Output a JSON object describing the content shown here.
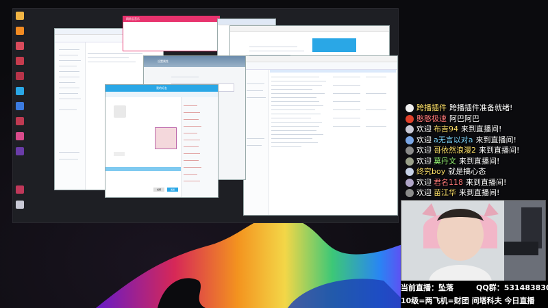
{
  "chat": {
    "messages": [
      {
        "prefix": "",
        "name": "跨播插件",
        "text": "跨播插件准备就绪!",
        "avatar_color": "#f0f0f0"
      },
      {
        "prefix": "",
        "name": "憨憨极速",
        "text": "阿巴阿巴",
        "avatar_color": "#e0402a"
      },
      {
        "prefix": "欢迎",
        "name": "布吉94",
        "text": "来到直播间!",
        "avatar_color": "#c9c9d6"
      },
      {
        "prefix": "欢迎",
        "name": "a无言以对a",
        "text": "来到直播间!",
        "avatar_color": "#7aa6e6"
      },
      {
        "prefix": "欢迎",
        "name": "哥依然浪漫2",
        "text": "来到直播间!",
        "avatar_color": "#8a8a8a"
      },
      {
        "prefix": "欢迎",
        "name": "莫丹文",
        "text": "来到直播间!",
        "avatar_color": "#9aa08a"
      },
      {
        "prefix": "",
        "name": "终究boy",
        "text": "就是搞心态",
        "avatar_color": "#c8d2e8"
      },
      {
        "prefix": "欢迎",
        "name": "君名118",
        "text": "来到直播间!",
        "avatar_color": "#b0a5c8"
      },
      {
        "prefix": "欢迎",
        "name": "苗江华",
        "text": "来到直播间!",
        "avatar_color": "#8b8b8b"
      }
    ]
  },
  "stream_info": {
    "current_label": "当前直播：坠落",
    "qq_group": "QQ群：531483830",
    "ticker": "10级=两飞机=财团   间塔科夫  今日直播"
  },
  "screen": {
    "browser_tab": "网易云音乐",
    "dialog_title": "设置属性",
    "chat_window_title": "我的好友",
    "send_button": "发送",
    "close_button": "关闭"
  },
  "colors": {
    "accent_pink": "#e8336e",
    "qq_blue": "#2aa7e6",
    "nick_yellow": "#ffe26a"
  }
}
